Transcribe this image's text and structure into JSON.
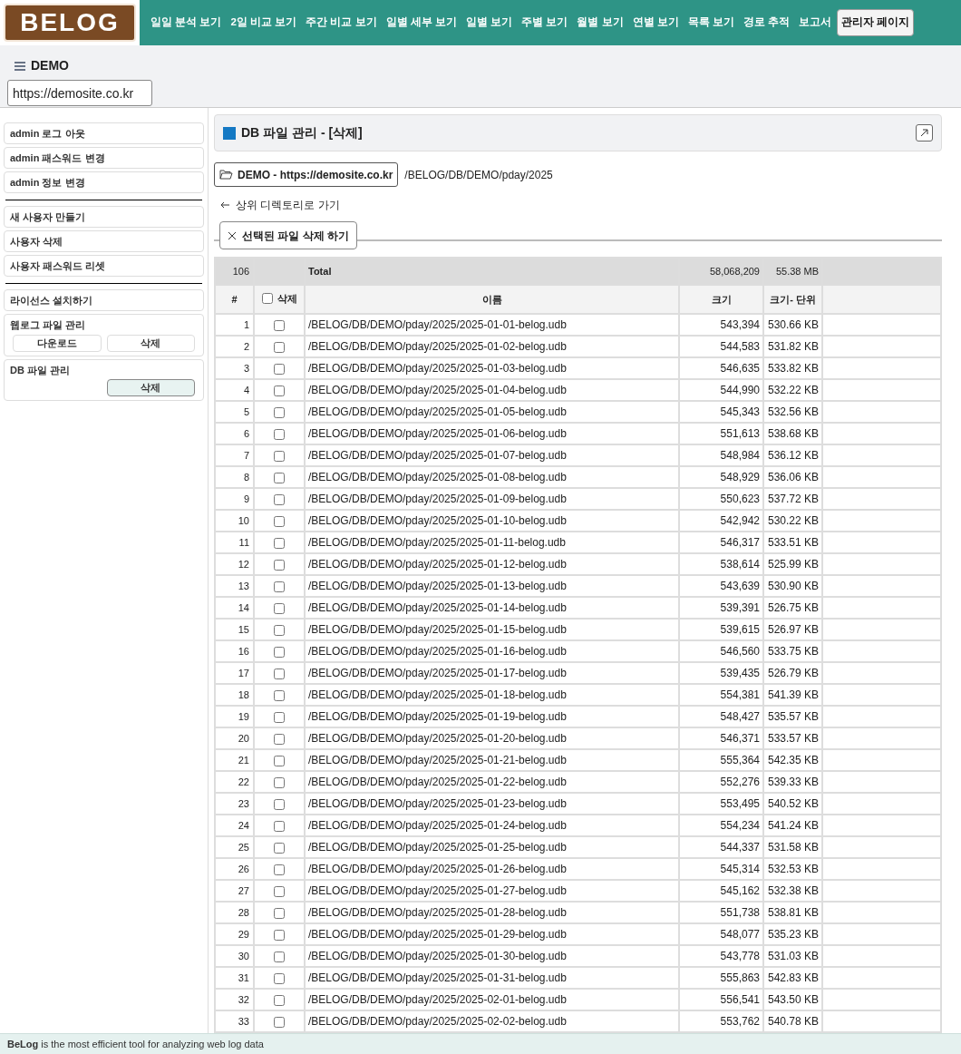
{
  "header": {
    "logo": "BELOG",
    "nav": [
      {
        "label": "일일 분석 보기",
        "selected": false
      },
      {
        "label": "2일 비교 보기",
        "selected": false
      },
      {
        "label": "주간 비교 보기",
        "selected": false
      },
      {
        "label": "일별 세부 보기",
        "selected": false
      },
      {
        "label": "일별 보기",
        "selected": false
      },
      {
        "label": "주별 보기",
        "selected": false
      },
      {
        "label": "월별 보기",
        "selected": false
      },
      {
        "label": "연별 보기",
        "selected": false
      },
      {
        "label": "목록 보기",
        "selected": false
      },
      {
        "label": "경로 추적",
        "selected": false
      },
      {
        "label": "보고서",
        "selected": false
      },
      {
        "label": "관리자 페이지",
        "selected": true
      }
    ]
  },
  "site": {
    "name": "DEMO",
    "url": "https://demosite.co.kr"
  },
  "sidebar": {
    "groups": [
      [
        "admin 로그 아웃",
        "admin 패스워드 변경",
        "admin 정보 변경"
      ],
      [
        "새 사용자 만들기",
        "사용자 삭제",
        "사용자 패스워드 리셋"
      ],
      [
        "라이선스 설치하기"
      ]
    ],
    "sections": [
      {
        "title": "웹로그 파일 관리",
        "buttons": [
          {
            "label": "다운로드",
            "selected": false
          },
          {
            "label": "삭제",
            "selected": false
          }
        ]
      },
      {
        "title": "DB 파일 관리",
        "buttons": [
          {
            "label": "삭제",
            "selected": true
          }
        ]
      }
    ]
  },
  "panel": {
    "title": "DB 파일 관리 - [삭제]",
    "folder_button": "DEMO - https://demosite.co.kr",
    "path": "/BELOG/DB/DEMO/pday/2025",
    "up_link": "상위 디렉토리로 가기",
    "delete_button": "선택된 파일 삭제 하기"
  },
  "table": {
    "total": {
      "count": "106",
      "label": "Total",
      "size": "58,068,209",
      "unit": "55.38 MB"
    },
    "columns": [
      "#",
      "삭제",
      "이름",
      "크기",
      "크기- 단위"
    ],
    "select_all_checked": false,
    "rows": [
      {
        "no": "1",
        "checked": false,
        "name": "/BELOG/DB/DEMO/pday/2025/2025-01-01-belog.udb",
        "size": "543,394",
        "unit": "530.66 KB"
      },
      {
        "no": "2",
        "checked": false,
        "name": "/BELOG/DB/DEMO/pday/2025/2025-01-02-belog.udb",
        "size": "544,583",
        "unit": "531.82 KB"
      },
      {
        "no": "3",
        "checked": false,
        "name": "/BELOG/DB/DEMO/pday/2025/2025-01-03-belog.udb",
        "size": "546,635",
        "unit": "533.82 KB"
      },
      {
        "no": "4",
        "checked": false,
        "name": "/BELOG/DB/DEMO/pday/2025/2025-01-04-belog.udb",
        "size": "544,990",
        "unit": "532.22 KB"
      },
      {
        "no": "5",
        "checked": false,
        "name": "/BELOG/DB/DEMO/pday/2025/2025-01-05-belog.udb",
        "size": "545,343",
        "unit": "532.56 KB"
      },
      {
        "no": "6",
        "checked": false,
        "name": "/BELOG/DB/DEMO/pday/2025/2025-01-06-belog.udb",
        "size": "551,613",
        "unit": "538.68 KB"
      },
      {
        "no": "7",
        "checked": false,
        "name": "/BELOG/DB/DEMO/pday/2025/2025-01-07-belog.udb",
        "size": "548,984",
        "unit": "536.12 KB"
      },
      {
        "no": "8",
        "checked": false,
        "name": "/BELOG/DB/DEMO/pday/2025/2025-01-08-belog.udb",
        "size": "548,929",
        "unit": "536.06 KB"
      },
      {
        "no": "9",
        "checked": false,
        "name": "/BELOG/DB/DEMO/pday/2025/2025-01-09-belog.udb",
        "size": "550,623",
        "unit": "537.72 KB"
      },
      {
        "no": "10",
        "checked": false,
        "name": "/BELOG/DB/DEMO/pday/2025/2025-01-10-belog.udb",
        "size": "542,942",
        "unit": "530.22 KB"
      },
      {
        "no": "11",
        "checked": false,
        "name": "/BELOG/DB/DEMO/pday/2025/2025-01-11-belog.udb",
        "size": "546,317",
        "unit": "533.51 KB"
      },
      {
        "no": "12",
        "checked": false,
        "name": "/BELOG/DB/DEMO/pday/2025/2025-01-12-belog.udb",
        "size": "538,614",
        "unit": "525.99 KB"
      },
      {
        "no": "13",
        "checked": false,
        "name": "/BELOG/DB/DEMO/pday/2025/2025-01-13-belog.udb",
        "size": "543,639",
        "unit": "530.90 KB"
      },
      {
        "no": "14",
        "checked": false,
        "name": "/BELOG/DB/DEMO/pday/2025/2025-01-14-belog.udb",
        "size": "539,391",
        "unit": "526.75 KB"
      },
      {
        "no": "15",
        "checked": false,
        "name": "/BELOG/DB/DEMO/pday/2025/2025-01-15-belog.udb",
        "size": "539,615",
        "unit": "526.97 KB"
      },
      {
        "no": "16",
        "checked": false,
        "name": "/BELOG/DB/DEMO/pday/2025/2025-01-16-belog.udb",
        "size": "546,560",
        "unit": "533.75 KB"
      },
      {
        "no": "17",
        "checked": false,
        "name": "/BELOG/DB/DEMO/pday/2025/2025-01-17-belog.udb",
        "size": "539,435",
        "unit": "526.79 KB"
      },
      {
        "no": "18",
        "checked": false,
        "name": "/BELOG/DB/DEMO/pday/2025/2025-01-18-belog.udb",
        "size": "554,381",
        "unit": "541.39 KB"
      },
      {
        "no": "19",
        "checked": false,
        "name": "/BELOG/DB/DEMO/pday/2025/2025-01-19-belog.udb",
        "size": "548,427",
        "unit": "535.57 KB"
      },
      {
        "no": "20",
        "checked": false,
        "name": "/BELOG/DB/DEMO/pday/2025/2025-01-20-belog.udb",
        "size": "546,371",
        "unit": "533.57 KB"
      },
      {
        "no": "21",
        "checked": false,
        "name": "/BELOG/DB/DEMO/pday/2025/2025-01-21-belog.udb",
        "size": "555,364",
        "unit": "542.35 KB"
      },
      {
        "no": "22",
        "checked": false,
        "name": "/BELOG/DB/DEMO/pday/2025/2025-01-22-belog.udb",
        "size": "552,276",
        "unit": "539.33 KB"
      },
      {
        "no": "23",
        "checked": false,
        "name": "/BELOG/DB/DEMO/pday/2025/2025-01-23-belog.udb",
        "size": "553,495",
        "unit": "540.52 KB"
      },
      {
        "no": "24",
        "checked": false,
        "name": "/BELOG/DB/DEMO/pday/2025/2025-01-24-belog.udb",
        "size": "554,234",
        "unit": "541.24 KB"
      },
      {
        "no": "25",
        "checked": false,
        "name": "/BELOG/DB/DEMO/pday/2025/2025-01-25-belog.udb",
        "size": "544,337",
        "unit": "531.58 KB"
      },
      {
        "no": "26",
        "checked": false,
        "name": "/BELOG/DB/DEMO/pday/2025/2025-01-26-belog.udb",
        "size": "545,314",
        "unit": "532.53 KB"
      },
      {
        "no": "27",
        "checked": false,
        "name": "/BELOG/DB/DEMO/pday/2025/2025-01-27-belog.udb",
        "size": "545,162",
        "unit": "532.38 KB"
      },
      {
        "no": "28",
        "checked": false,
        "name": "/BELOG/DB/DEMO/pday/2025/2025-01-28-belog.udb",
        "size": "551,738",
        "unit": "538.81 KB"
      },
      {
        "no": "29",
        "checked": false,
        "name": "/BELOG/DB/DEMO/pday/2025/2025-01-29-belog.udb",
        "size": "548,077",
        "unit": "535.23 KB"
      },
      {
        "no": "30",
        "checked": false,
        "name": "/BELOG/DB/DEMO/pday/2025/2025-01-30-belog.udb",
        "size": "543,778",
        "unit": "531.03 KB"
      },
      {
        "no": "31",
        "checked": false,
        "name": "/BELOG/DB/DEMO/pday/2025/2025-01-31-belog.udb",
        "size": "555,863",
        "unit": "542.83 KB"
      },
      {
        "no": "32",
        "checked": false,
        "name": "/BELOG/DB/DEMO/pday/2025/2025-02-01-belog.udb",
        "size": "556,541",
        "unit": "543.50 KB"
      },
      {
        "no": "33",
        "checked": false,
        "name": "/BELOG/DB/DEMO/pday/2025/2025-02-02-belog.udb",
        "size": "553,762",
        "unit": "540.78 KB"
      }
    ]
  },
  "footer": "**BeLog** is the most efficient tool for analyzing web log data"
}
